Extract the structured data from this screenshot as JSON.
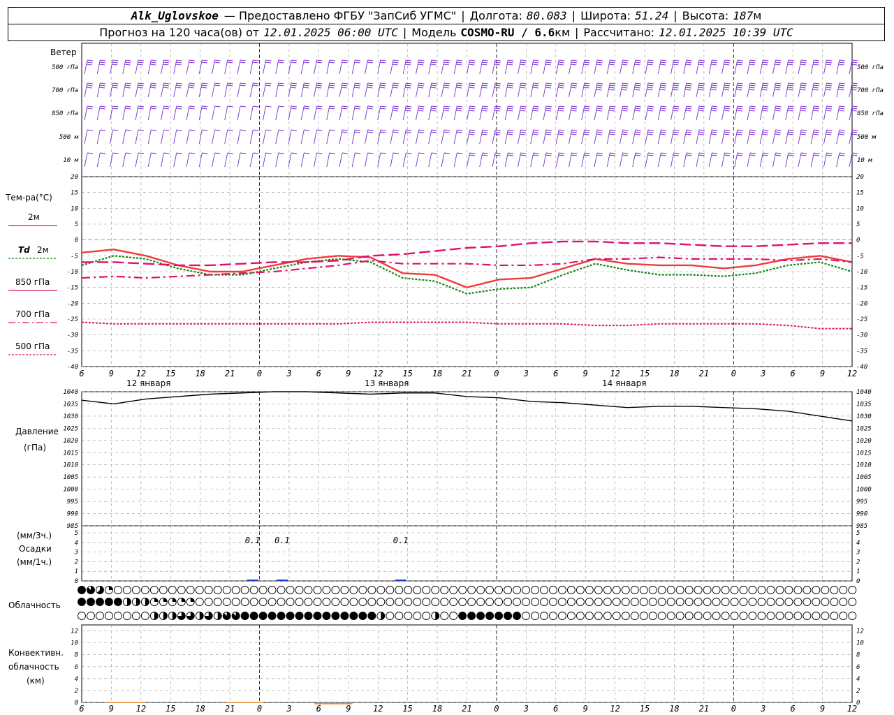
{
  "header": {
    "station": "Alk_Uglovskoe",
    "provider": "— Предоставлено ФГБУ \"ЗапСиб УГМС\"",
    "lon_label": "Долгота:",
    "lon_value": "80.083",
    "lat_label": "Широта:",
    "lat_value": "51.24",
    "alt_label": "Высота:",
    "alt_value": "187",
    "alt_unit": "м",
    "forecast_label": "Прогноз на 120 часа(ов) от",
    "forecast_time": "12.01.2025 06:00 UTC",
    "model_label": "Модель",
    "model_value": "COSMO-RU / 6.6",
    "model_unit": "км",
    "calc_label": "Рассчитано:",
    "calc_time": "12.01.2025 10:39 UTC"
  },
  "labels": {
    "wind": "Ветер",
    "temp": "Тем-ра(°C)",
    "t2m": "2м",
    "td_sym": "Td",
    "td_2m": "2м",
    "p850": "850 гПа",
    "p700": "700 гПа",
    "p500": "500 гПа",
    "pressure": "Давление",
    "pressure_unit": "(гПа)",
    "precip_3h": "(мм/3ч.)",
    "precip": "Осадки",
    "precip_1h": "(мм/1ч.)",
    "cloud": "Облачность",
    "conv1": "Конвективн.",
    "conv2": "облачность",
    "conv3": "(км)",
    "day1": "12 января",
    "day2": "13 января",
    "day3": "14 января"
  },
  "colors": {
    "t2m": "#ef3b3b",
    "td": "#118811",
    "p850": "#e0106a",
    "p700": "#e0106a",
    "p500": "#e0106a",
    "wind": "#7a2fd0",
    "pressure": "#000000",
    "precip": "#1a3cc8",
    "conv": "#e87d1e",
    "grid": "#9a9a9a"
  },
  "chart_data": [
    {
      "type": "line",
      "name": "wind barbs",
      "levels": [
        "500 гПа",
        "700 гПа",
        "850 гПа",
        "500 м",
        "10 м"
      ],
      "level_y_labels": [
        "500 гПа",
        "700 гПа",
        "850 гПа",
        "500 м",
        "10 м"
      ],
      "speed_kt": [
        [
          25,
          25,
          25,
          25,
          25,
          25,
          25,
          25,
          20,
          20,
          15,
          15,
          15,
          15,
          15,
          15,
          20,
          20,
          20,
          20,
          20,
          20,
          20,
          20,
          25,
          25,
          25,
          25,
          25,
          25,
          30,
          30,
          30,
          30,
          30,
          30,
          30,
          30,
          30,
          30,
          30,
          30,
          30,
          30,
          30,
          30,
          30,
          30,
          30,
          30,
          30,
          30,
          30,
          30,
          30,
          30,
          30,
          30,
          30,
          30,
          30
        ],
        [
          30,
          30,
          30,
          30,
          30,
          30,
          30,
          30,
          25,
          25,
          20,
          20,
          20,
          20,
          20,
          20,
          25,
          25,
          25,
          25,
          25,
          25,
          25,
          25,
          30,
          30,
          30,
          30,
          30,
          30,
          30,
          30,
          30,
          30,
          30,
          30,
          30,
          30,
          30,
          30,
          35,
          35,
          35,
          35,
          35,
          35,
          35,
          35,
          35,
          35,
          35,
          35,
          35,
          35,
          35,
          35,
          35,
          35,
          35,
          35,
          35
        ],
        [
          20,
          20,
          20,
          20,
          20,
          20,
          15,
          15,
          15,
          15,
          10,
          10,
          10,
          10,
          10,
          10,
          15,
          15,
          15,
          15,
          20,
          20,
          20,
          20,
          25,
          25,
          25,
          25,
          25,
          25,
          25,
          25,
          25,
          25,
          25,
          25,
          25,
          25,
          25,
          25,
          25,
          25,
          25,
          25,
          25,
          25,
          25,
          25,
          25,
          25,
          25,
          25,
          25,
          25,
          25,
          25,
          25,
          25,
          25,
          25,
          25
        ],
        [
          10,
          10,
          10,
          10,
          10,
          5,
          5,
          5,
          5,
          5,
          5,
          5,
          5,
          5,
          5,
          5,
          10,
          10,
          10,
          10,
          15,
          15,
          15,
          15,
          20,
          20,
          20,
          20,
          20,
          20,
          25,
          25,
          25,
          25,
          25,
          25,
          25,
          25,
          25,
          25,
          30,
          30,
          30,
          30,
          30,
          30,
          30,
          30,
          30,
          30,
          30,
          30,
          30,
          30,
          30,
          30,
          30,
          30,
          30,
          30,
          30
        ],
        [
          5,
          5,
          5,
          5,
          5,
          5,
          5,
          5,
          5,
          5,
          5,
          5,
          5,
          5,
          5,
          5,
          5,
          5,
          5,
          5,
          10,
          10,
          10,
          10,
          10,
          10,
          10,
          10,
          10,
          10,
          15,
          15,
          15,
          15,
          15,
          15,
          15,
          15,
          15,
          15,
          15,
          15,
          15,
          15,
          15,
          15,
          15,
          15,
          15,
          15,
          15,
          15,
          15,
          15,
          15,
          15,
          15,
          15,
          15,
          15,
          15
        ]
      ]
    },
    {
      "type": "line",
      "title": "Тем-ра(°C)",
      "ylim": [
        -40,
        20
      ],
      "yticks": [
        20,
        15,
        10,
        5,
        0,
        -5,
        -10,
        -15,
        -20,
        -25,
        -30,
        -35,
        -40
      ],
      "x_hours": [
        0,
        3,
        6,
        9,
        12,
        15,
        18,
        21,
        24,
        27,
        30,
        33,
        36,
        39,
        42,
        45,
        48,
        51,
        54,
        57,
        60,
        63,
        66,
        69,
        72,
        75,
        78
      ],
      "x_tick_labels": [
        "6",
        "9",
        "12",
        "15",
        "18",
        "21",
        "0",
        "3",
        "6",
        "9",
        "12",
        "15",
        "18",
        "21",
        "0",
        "3",
        "6",
        "9",
        "12",
        "15",
        "18",
        "21",
        "0",
        "3",
        "6",
        "9",
        "12"
      ],
      "series": [
        {
          "name": "2м",
          "values": [
            -4,
            -3,
            -5,
            -8,
            -10,
            -10,
            -8,
            -6,
            -5,
            -5.5,
            -10.5,
            -11,
            -15,
            -12.5,
            -12,
            -9,
            -6,
            -7.5,
            -8,
            -8,
            -9,
            -8,
            -6,
            -5,
            -7
          ]
        },
        {
          "name": "Td 2м",
          "values": [
            -8,
            -5,
            -6,
            -9,
            -11,
            -11,
            -9,
            -7,
            -6,
            -7,
            -12,
            -13,
            -17,
            -15.5,
            -15,
            -11,
            -7.5,
            -9.5,
            -11,
            -11,
            -11.5,
            -10.5,
            -8,
            -7,
            -10
          ]
        },
        {
          "name": "850 гПа",
          "values": [
            -7,
            -7,
            -7.5,
            -8,
            -8,
            -7.5,
            -7,
            -7,
            -6.5,
            -5,
            -4.5,
            -3.5,
            -2.5,
            -2,
            -1,
            -0.5,
            -0.5,
            -1,
            -1,
            -1.5,
            -2,
            -2,
            -1.5,
            -1,
            -1
          ]
        },
        {
          "name": "700 гПа",
          "values": [
            -12,
            -11.5,
            -12,
            -11.5,
            -11,
            -10.5,
            -10,
            -9,
            -8,
            -6.5,
            -7.5,
            -7.5,
            -7.5,
            -8,
            -8,
            -7.5,
            -6,
            -6,
            -5.5,
            -6,
            -6,
            -6,
            -6.5,
            -6,
            -7
          ]
        },
        {
          "name": "500 гПа",
          "values": [
            -26,
            -26.5,
            -26.5,
            -26.5,
            -26.5,
            -26.5,
            -26.5,
            -26.5,
            -26.5,
            -26,
            -26,
            -26,
            -26,
            -26.5,
            -26.5,
            -26.5,
            -27,
            -27,
            -26.5,
            -26.5,
            -26.5,
            -26.5,
            -27,
            -28,
            -28
          ]
        }
      ],
      "series_x_step_hours": 3.25,
      "day_labels": [
        "12 января",
        "13 января",
        "14 января"
      ]
    },
    {
      "type": "line",
      "title": "Давление",
      "ylabel": "(гПа)",
      "ylim": [
        985,
        1040
      ],
      "yticks": [
        1040,
        1035,
        1030,
        1025,
        1020,
        1015,
        1010,
        1005,
        1000,
        995,
        990,
        985
      ],
      "series": [
        {
          "name": "Давление",
          "values": [
            1036.5,
            1035,
            1037,
            1038,
            1039,
            1039.5,
            1040,
            1040,
            1039.5,
            1039,
            1039.5,
            1039.5,
            1038,
            1037.5,
            1036,
            1035.5,
            1034.5,
            1033.5,
            1034,
            1034,
            1033.5,
            1033,
            1032,
            1030,
            1028
          ]
        }
      ]
    },
    {
      "type": "bar",
      "title": "Осадки",
      "ylim": [
        0,
        5
      ],
      "yticks": [
        5,
        4,
        3,
        2,
        1,
        0
      ],
      "annotations": [
        {
          "hour_label": "0",
          "text": "0.1"
        },
        {
          "hour_label": "3",
          "text": "0.1"
        },
        {
          "hour_label": "15",
          "text": "0.1"
        }
      ]
    },
    {
      "type": "table",
      "title": "Облачность",
      "legend": "okta: 0 = empty circle, 8 = filled circle",
      "rows": [
        [
          8,
          7,
          5,
          2,
          0,
          0,
          0,
          0,
          0,
          0,
          0,
          0,
          0,
          0,
          0,
          0,
          0,
          0,
          0,
          0,
          0,
          0,
          0,
          0,
          0,
          0,
          0,
          0,
          0,
          0,
          0,
          0,
          0,
          0,
          0,
          0,
          0,
          0,
          0,
          0,
          0,
          0,
          0,
          0,
          0,
          0,
          0,
          0,
          0,
          0,
          0,
          0,
          0,
          0,
          0,
          0,
          0,
          0,
          0,
          0,
          0,
          0,
          0,
          0,
          0,
          0,
          0,
          0,
          0,
          0,
          0,
          0,
          0,
          0,
          0,
          0,
          0,
          0,
          0,
          0,
          0,
          0,
          0,
          0,
          0,
          0,
          0,
          0,
          0,
          0,
          0,
          0,
          0
        ],
        [
          8,
          8,
          8,
          8,
          8,
          4,
          4,
          4,
          2,
          2,
          2,
          2,
          2,
          0,
          0,
          0,
          0,
          0,
          0,
          0,
          0,
          0,
          0,
          0,
          0,
          0,
          0,
          0,
          0,
          0,
          0,
          0,
          0,
          0,
          0,
          0,
          0,
          0,
          0,
          0,
          0,
          0,
          0,
          0,
          0,
          0,
          0,
          0,
          0,
          0,
          0,
          0,
          0,
          0,
          0,
          0,
          0,
          0,
          0,
          0,
          0,
          0,
          0,
          0,
          0,
          0,
          0,
          0,
          0,
          0,
          0,
          0,
          0,
          0,
          0,
          0,
          0,
          0,
          0,
          0,
          0,
          0,
          0,
          0,
          0,
          0,
          0,
          0,
          0,
          0,
          0,
          0,
          0
        ],
        [
          0,
          0,
          0,
          0,
          0,
          0,
          0,
          0,
          4,
          4,
          4,
          6,
          6,
          4,
          6,
          4,
          7,
          7,
          8,
          8,
          8,
          8,
          8,
          8,
          8,
          8,
          8,
          8,
          8,
          8,
          8,
          8,
          8,
          4,
          0,
          0,
          0,
          0,
          0,
          4,
          0,
          0,
          8,
          8,
          8,
          8,
          8,
          8,
          8,
          0,
          0,
          0,
          0,
          0,
          0,
          0,
          0,
          0,
          0,
          0,
          0,
          0,
          0,
          0,
          0,
          0,
          0,
          0,
          0,
          0,
          0,
          0,
          0,
          0,
          0,
          0,
          0,
          0,
          0,
          0,
          0,
          0,
          0,
          0,
          0,
          0,
          0,
          0,
          0,
          0,
          0,
          0,
          0
        ]
      ]
    },
    {
      "type": "bar",
      "title": "Конвективн. облачность",
      "ylabel": "(км)",
      "ylim": [
        0,
        13
      ],
      "yticks": [
        12,
        10,
        8,
        6,
        4,
        2,
        0
      ],
      "segments_km": [
        {
          "from_label": "9",
          "to_label": "12",
          "value": 0.8
        },
        {
          "from_label": "21",
          "to_label": "0",
          "value": 0.8
        },
        {
          "from_label": "6",
          "to_label": "9",
          "value": 0.6
        }
      ],
      "x_tick_labels": [
        "6",
        "9",
        "12",
        "15",
        "18",
        "21",
        "0",
        "3",
        "6",
        "9",
        "12",
        "15",
        "18",
        "21",
        "0",
        "3",
        "6",
        "9",
        "12",
        "15",
        "18",
        "21",
        "0",
        "3",
        "6",
        "9",
        "12"
      ]
    }
  ]
}
